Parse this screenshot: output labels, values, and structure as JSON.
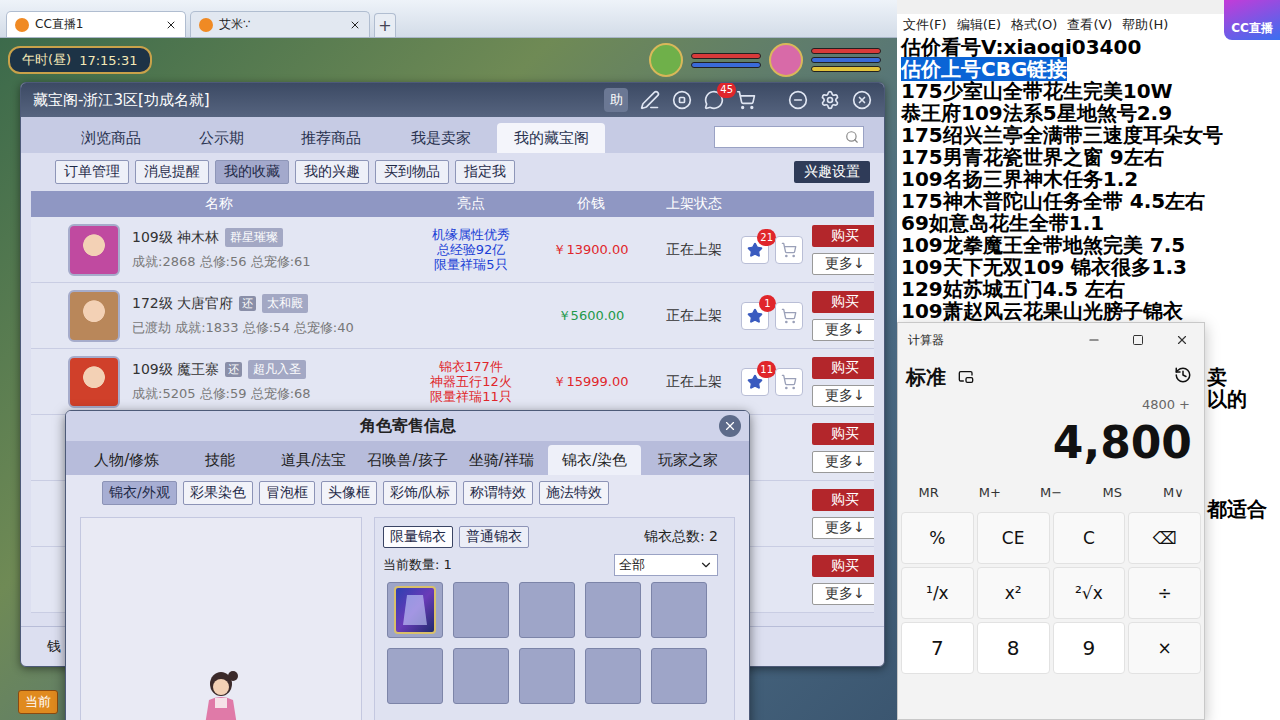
{
  "browser": {
    "tabs": [
      {
        "label": "CC直播1",
        "selected": true
      },
      {
        "label": "艾米∵",
        "selected": false
      }
    ],
    "new_tab": "+"
  },
  "game": {
    "clock": {
      "period": "午时(昼)",
      "time": "17:15:31"
    },
    "money_label": "钱",
    "bottom_button": "当前"
  },
  "cbg": {
    "title": "藏宝阁-浙江3区[功成名就]",
    "help": "助",
    "message_count": "45",
    "tabs": [
      {
        "label": "浏览商品",
        "selected": false
      },
      {
        "label": "公示期",
        "selected": false
      },
      {
        "label": "推荐商品",
        "selected": false
      },
      {
        "label": "我是卖家",
        "selected": false
      },
      {
        "label": "我的藏宝阁",
        "selected": true
      }
    ],
    "subtabs": [
      {
        "label": "订单管理",
        "selected": false
      },
      {
        "label": "消息提醒",
        "selected": false
      },
      {
        "label": "我的收藏",
        "selected": true
      },
      {
        "label": "我的兴趣",
        "selected": false
      },
      {
        "label": "买到物品",
        "selected": false
      },
      {
        "label": "指定我",
        "selected": false
      }
    ],
    "interest_button": "兴趣设置",
    "columns": [
      "名称",
      "亮点",
      "价钱",
      "上架状态"
    ],
    "rows": [
      {
        "name": "109级 神木林",
        "marks": [],
        "tag": "群星璀璨",
        "stats": "成就:2868 总修:56 总宠修:61",
        "highlights": [
          "机缘属性优秀",
          "总经验92亿",
          "限量祥瑞5只"
        ],
        "highlight_color": "#1a3fd6",
        "price": "￥13900.00",
        "price_color": "#e0262b",
        "status": "正在上架",
        "favorites": "21",
        "buy": "购买",
        "more": "更多↓",
        "avatar_color": "#c04aa0"
      },
      {
        "name": "172级 大唐官府",
        "marks": [
          "还"
        ],
        "tag": "太和殿",
        "stats": "已渡劫 成就:1833 总修:54 总宠修:40",
        "highlights": [],
        "highlight_color": "#1a3fd6",
        "price": "￥5600.00",
        "price_color": "#23994a",
        "status": "正在上架",
        "favorites": "1",
        "buy": "购买",
        "more": "更多↓",
        "avatar_color": "#b9875a"
      },
      {
        "name": "109级 魔王寨",
        "marks": [
          "还"
        ],
        "tag": "超凡入圣",
        "stats": "成就:5205 总修:59 总宠修:68",
        "highlights": [
          "锦衣177件",
          "神器五行12火",
          "限量祥瑞11只"
        ],
        "highlight_color": "#e0262b",
        "price": "￥15999.00",
        "price_color": "#e0262b",
        "status": "正在上架",
        "favorites": "11",
        "buy": "购买",
        "more": "更多↓",
        "avatar_color": "#d0402a"
      }
    ],
    "covered_rows": [
      {
        "buy": "购买",
        "more": "更多↓"
      },
      {
        "buy": "购买",
        "more": "更多↓"
      },
      {
        "buy": "购买",
        "more": "更多↓"
      }
    ]
  },
  "dialog": {
    "title": "角色寄售信息",
    "tabs": [
      {
        "label": "人物/修炼",
        "selected": false
      },
      {
        "label": "技能",
        "selected": false
      },
      {
        "label": "道具/法宝",
        "selected": false
      },
      {
        "label": "召唤兽/孩子",
        "selected": false
      },
      {
        "label": "坐骑/祥瑞",
        "selected": false
      },
      {
        "label": "锦衣/染色",
        "selected": true
      },
      {
        "label": "玩家之家",
        "selected": false
      }
    ],
    "subtabs": [
      {
        "label": "锦衣/外观",
        "selected": true
      },
      {
        "label": "彩果染色",
        "selected": false
      },
      {
        "label": "冒泡框",
        "selected": false
      },
      {
        "label": "头像框",
        "selected": false
      },
      {
        "label": "彩饰/队标",
        "selected": false
      },
      {
        "label": "称谓特效",
        "selected": false
      },
      {
        "label": "施法特效",
        "selected": false
      }
    ],
    "kind_tabs": [
      {
        "label": "限量锦衣",
        "selected": true
      },
      {
        "label": "普通锦衣",
        "selected": false
      }
    ],
    "total": "锦衣总数: 2",
    "current": "当前数量: 1",
    "filter": "全部",
    "slots": [
      {
        "filled": true
      },
      {
        "filled": false
      },
      {
        "filled": false
      },
      {
        "filled": false
      },
      {
        "filled": false
      },
      {
        "filled": false
      },
      {
        "filled": false
      },
      {
        "filled": false
      },
      {
        "filled": false
      },
      {
        "filled": false
      }
    ]
  },
  "notepad": {
    "menu": [
      "文件(F)",
      "编辑(E)",
      "格式(O)",
      "查看(V)",
      "帮助(H)"
    ],
    "lines": [
      {
        "text": "估价看号V:xiaoqi03400",
        "kind": "line",
        "selected": false
      },
      {
        "text": "估价上号CBG链接",
        "kind": "line",
        "selected": true
      },
      {
        "text": "175少室山全带花生完美10W",
        "kind": "line",
        "selected": false
      },
      {
        "text": "恭王府109法系5星地煞号2.9",
        "kind": "line",
        "selected": false
      },
      {
        "text": "175绍兴兰亭全满带三速度耳朵女号",
        "kind": "line",
        "selected": false
      },
      {
        "text": "175男青花瓷世界之窗  9左右",
        "kind": "line",
        "selected": false
      },
      {
        "text": "109名扬三界神木任务1.2",
        "kind": "line",
        "selected": false
      },
      {
        "text": "175神木普陀山任务全带 4.5左右",
        "kind": "line",
        "selected": false
      },
      {
        "text": "69如意岛花生全带1.1",
        "kind": "line",
        "selected": false
      },
      {
        "text": "109龙拳魔王全带地煞完美 7.5",
        "kind": "line",
        "selected": false
      },
      {
        "text": "109天下无双109  锦衣很多1.3",
        "kind": "line",
        "selected": false
      },
      {
        "text": "129姑苏城五门4.5 左右",
        "kind": "line",
        "selected": false
      },
      {
        "text": "109萧赵风云花果山光膀子锦衣",
        "kind": "line",
        "selected": false
      },
      {
        "text": "",
        "kind": "blank",
        "selected": false
      },
      {
        "text": "",
        "kind": "blank",
        "selected": false
      },
      {
        "text": "卖",
        "kind": "tail",
        "selected": false
      },
      {
        "text": "以的",
        "kind": "tail",
        "selected": false
      },
      {
        "text": "",
        "kind": "blank",
        "selected": false
      },
      {
        "text": "",
        "kind": "blank",
        "selected": false
      },
      {
        "text": "",
        "kind": "blank",
        "selected": false
      },
      {
        "text": "",
        "kind": "blank",
        "selected": false
      },
      {
        "text": "都适合",
        "kind": "tail",
        "selected": false
      }
    ]
  },
  "calculator": {
    "title": "计算器",
    "mode": "标准",
    "history": "4800 +",
    "display": "4,800",
    "memory": [
      "MR",
      "M+",
      "M−",
      "MS",
      "M∨"
    ],
    "keys": [
      {
        "label": "%",
        "kind": "op"
      },
      {
        "label": "CE",
        "kind": "op"
      },
      {
        "label": "C",
        "kind": "op"
      },
      {
        "label": "⌫",
        "kind": "op"
      },
      {
        "label": "¹/x",
        "kind": "op"
      },
      {
        "label": "x²",
        "kind": "op"
      },
      {
        "label": "²√x",
        "kind": "op"
      },
      {
        "label": "÷",
        "kind": "op"
      },
      {
        "label": "7",
        "kind": "digit"
      },
      {
        "label": "8",
        "kind": "digit"
      },
      {
        "label": "9",
        "kind": "digit"
      },
      {
        "label": "×",
        "kind": "op"
      }
    ]
  },
  "logo": "CC直播"
}
